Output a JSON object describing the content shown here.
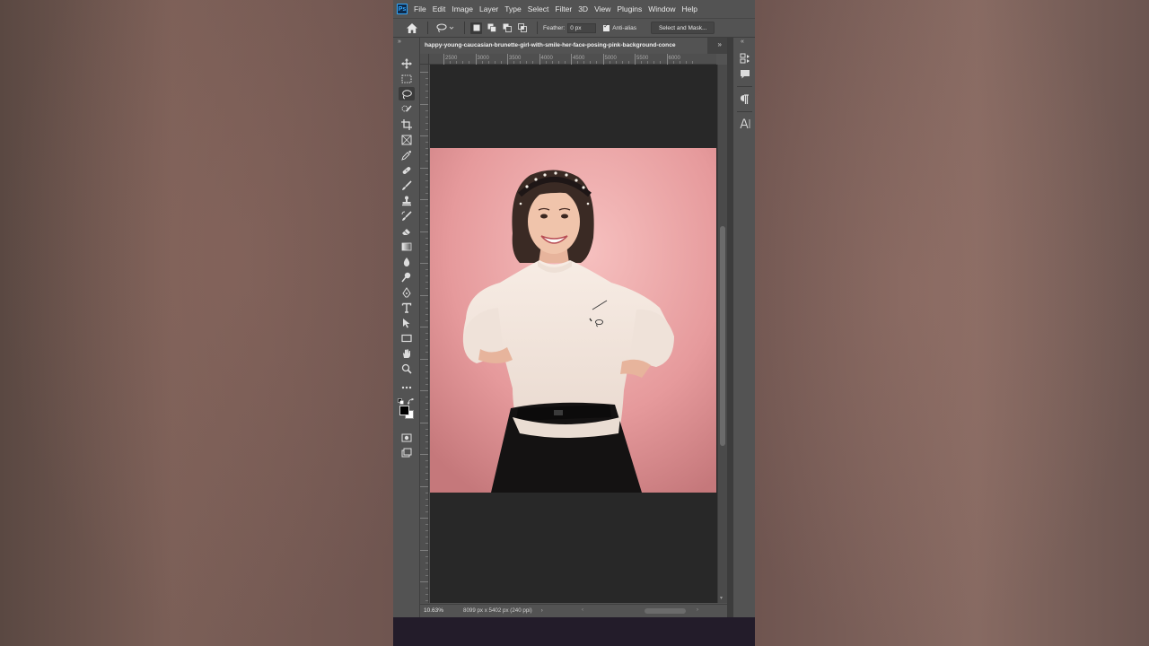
{
  "app": {
    "logo": "Ps"
  },
  "menu": [
    "File",
    "Edit",
    "Image",
    "Layer",
    "Type",
    "Select",
    "Filter",
    "3D",
    "View",
    "Plugins",
    "Window",
    "Help"
  ],
  "options": {
    "feather_label": "Feather:",
    "feather_value": "0 px",
    "antialias_label": "Anti-alias",
    "antialias_checked": true,
    "select_mask_label": "Select and Mask..."
  },
  "document": {
    "tab_title": "happy-young-caucasian-brunette-girl-with-smile-her-face-posing-pink-background-conce",
    "zoom": "10.63%",
    "info": "8099 px x 5402 px (240 ppi)"
  },
  "ruler": {
    "labels": [
      "2500",
      "3000",
      "3500",
      "4000",
      "4500",
      "5000",
      "5500",
      "6000"
    ]
  },
  "tools": [
    "move-tool-icon",
    "rectangular-marquee-icon",
    "lasso-tool-icon",
    "quick-selection-icon",
    "crop-tool-icon",
    "frame-tool-icon",
    "eyedropper-icon",
    "spot-healing-icon",
    "brush-tool-icon",
    "clone-stamp-icon",
    "history-brush-icon",
    "eraser-icon",
    "gradient-tool-icon",
    "blur-tool-icon",
    "dodge-tool-icon",
    "pen-tool-icon",
    "type-tool-icon",
    "path-selection-icon",
    "rectangle-tool-icon",
    "hand-tool-icon",
    "zoom-tool-icon",
    "more-tools-icon"
  ],
  "colors": {
    "foreground": "#000000",
    "background": "#ffffff",
    "canvas_bg": "#282828",
    "ui_bg": "#535353"
  },
  "right_panel": [
    "history-icon",
    "comments-icon",
    "paragraph-icon",
    "character-icon"
  ]
}
